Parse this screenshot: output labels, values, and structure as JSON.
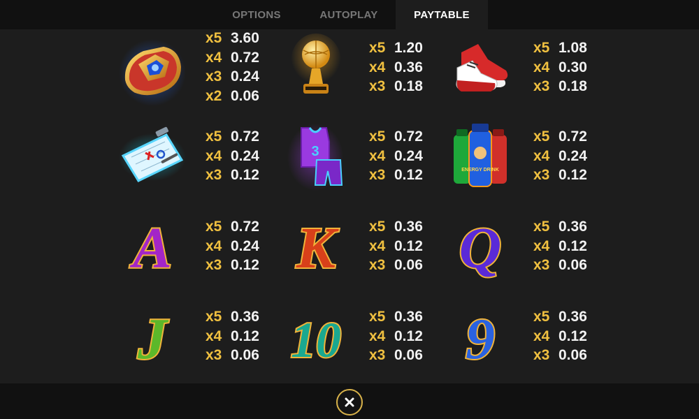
{
  "tabs": [
    {
      "label": "OPTIONS",
      "active": false
    },
    {
      "label": "AUTOPLAY",
      "active": false
    },
    {
      "label": "PAYTABLE",
      "active": true
    }
  ],
  "colors": {
    "background": "#1d1d1d",
    "bar": "#111111",
    "count_gold": "#f0c040",
    "value_white": "#f2f2f2",
    "close_ring": "#d8b24a"
  },
  "symbols": [
    {
      "icon": "championship-ring-icon",
      "payouts": [
        {
          "count": "x5",
          "value": "3.60"
        },
        {
          "count": "x4",
          "value": "0.72"
        },
        {
          "count": "x3",
          "value": "0.24"
        },
        {
          "count": "x2",
          "value": "0.06"
        }
      ]
    },
    {
      "icon": "trophy-icon",
      "payouts": [
        {
          "count": "x5",
          "value": "1.20"
        },
        {
          "count": "x4",
          "value": "0.36"
        },
        {
          "count": "x3",
          "value": "0.18"
        }
      ]
    },
    {
      "icon": "sneakers-icon",
      "payouts": [
        {
          "count": "x5",
          "value": "1.08"
        },
        {
          "count": "x4",
          "value": "0.30"
        },
        {
          "count": "x3",
          "value": "0.18"
        }
      ]
    },
    {
      "icon": "clipboard-icon",
      "payouts": [
        {
          "count": "x5",
          "value": "0.72"
        },
        {
          "count": "x4",
          "value": "0.24"
        },
        {
          "count": "x3",
          "value": "0.12"
        }
      ]
    },
    {
      "icon": "jersey-icon",
      "jersey_number": "3",
      "payouts": [
        {
          "count": "x5",
          "value": "0.72"
        },
        {
          "count": "x4",
          "value": "0.24"
        },
        {
          "count": "x3",
          "value": "0.12"
        }
      ]
    },
    {
      "icon": "energy-drinks-icon",
      "bottle_label": "ENERGY DRINK",
      "payouts": [
        {
          "count": "x5",
          "value": "0.72"
        },
        {
          "count": "x4",
          "value": "0.24"
        },
        {
          "count": "x3",
          "value": "0.12"
        }
      ]
    },
    {
      "icon": "letter-a-icon",
      "glyph": "A",
      "payouts": [
        {
          "count": "x5",
          "value": "0.72"
        },
        {
          "count": "x4",
          "value": "0.24"
        },
        {
          "count": "x3",
          "value": "0.12"
        }
      ]
    },
    {
      "icon": "letter-k-icon",
      "glyph": "K",
      "payouts": [
        {
          "count": "x5",
          "value": "0.36"
        },
        {
          "count": "x4",
          "value": "0.12"
        },
        {
          "count": "x3",
          "value": "0.06"
        }
      ]
    },
    {
      "icon": "letter-q-icon",
      "glyph": "Q",
      "payouts": [
        {
          "count": "x5",
          "value": "0.36"
        },
        {
          "count": "x4",
          "value": "0.12"
        },
        {
          "count": "x3",
          "value": "0.06"
        }
      ]
    },
    {
      "icon": "letter-j-icon",
      "glyph": "J",
      "payouts": [
        {
          "count": "x5",
          "value": "0.36"
        },
        {
          "count": "x4",
          "value": "0.12"
        },
        {
          "count": "x3",
          "value": "0.06"
        }
      ]
    },
    {
      "icon": "number-10-icon",
      "glyph": "10",
      "payouts": [
        {
          "count": "x5",
          "value": "0.36"
        },
        {
          "count": "x4",
          "value": "0.12"
        },
        {
          "count": "x3",
          "value": "0.06"
        }
      ]
    },
    {
      "icon": "number-9-icon",
      "glyph": "9",
      "payouts": [
        {
          "count": "x5",
          "value": "0.36"
        },
        {
          "count": "x4",
          "value": "0.12"
        },
        {
          "count": "x3",
          "value": "0.06"
        }
      ]
    }
  ],
  "close_icon": "close-icon"
}
